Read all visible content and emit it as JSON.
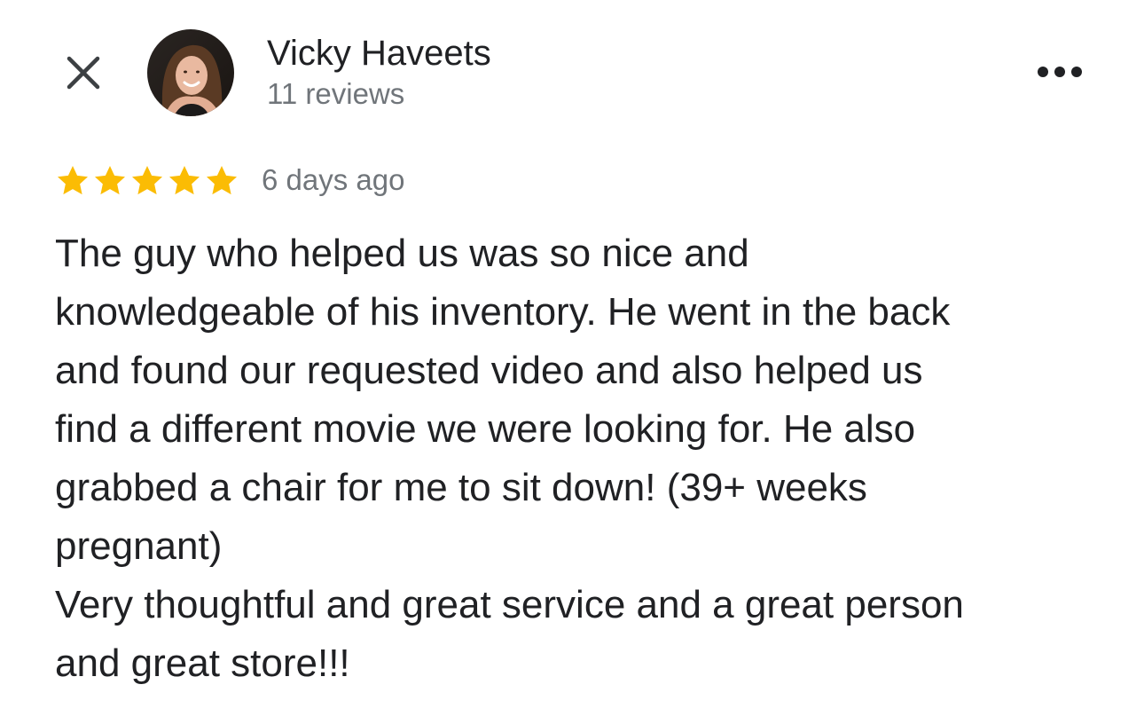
{
  "reviewer": {
    "name": "Vicky Haveets",
    "review_count": "11 reviews"
  },
  "review": {
    "rating": 5,
    "rating_max": 5,
    "date": "6 days ago",
    "lines": [
      "The guy who helped us was so nice and",
      "knowledgeable of his inventory. He went in the back",
      "and found our requested video and also helped us",
      "find a different movie we were looking for. He also",
      "grabbed a chair for me to sit down! (39+ weeks",
      "pregnant)",
      "Very thoughtful and great service and a great person",
      "and great store!!!"
    ]
  },
  "icons": {
    "close": "close-icon",
    "more": "more-horizontal-icon",
    "star": "star-icon"
  },
  "colors": {
    "star": "#fbbc04",
    "text": "#202124",
    "secondary_text": "#70757a",
    "icon": "#3c4043"
  }
}
